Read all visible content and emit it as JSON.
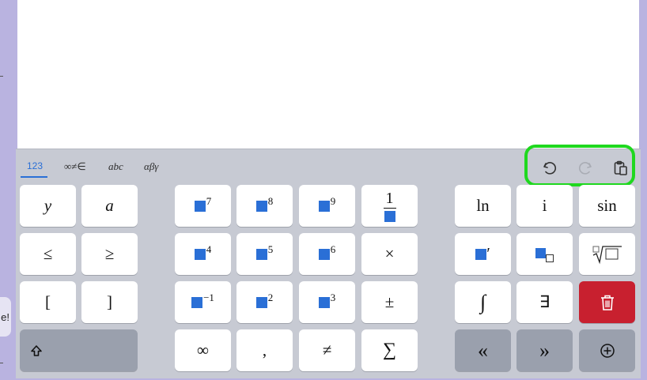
{
  "side": {
    "bubble_text": "e!"
  },
  "tabs": [
    {
      "label": "123",
      "active": true
    },
    {
      "label": "∞≠∈",
      "active": false
    },
    {
      "label": "abc",
      "active": false
    },
    {
      "label": "αβγ",
      "active": false
    }
  ],
  "toolbar": {
    "undo_icon": "undo-icon",
    "redo_icon": "redo-icon",
    "clipboard_icon": "clipboard-icon",
    "redo_enabled": false,
    "highlight_color": "#1fd81f"
  },
  "keys": {
    "y": "y",
    "a": "a",
    "le": "≤",
    "ge": "≥",
    "lbracket": "[",
    "rbracket": "]",
    "pow7": "7",
    "pow8": "8",
    "pow9": "9",
    "frac_num": "1",
    "pow4": "4",
    "pow5": "5",
    "pow6": "6",
    "times": "×",
    "pow_neg1": "−1",
    "pow2": "2",
    "pow3": "3",
    "plusminus": "±",
    "infinity": "∞",
    "comma": ",",
    "neq": "≠",
    "sum": "∑",
    "ln": "ln",
    "i": "i",
    "sin": "sin",
    "prime": "′",
    "integral": "∫",
    "exists": "∃",
    "left": "«",
    "right": "»",
    "add": "⊕"
  },
  "colors": {
    "accent": "#2a6fd6",
    "delete_key": "#c8202f",
    "keyboard_bg": "#c7cad3",
    "dark_key": "#9aa0ad"
  }
}
